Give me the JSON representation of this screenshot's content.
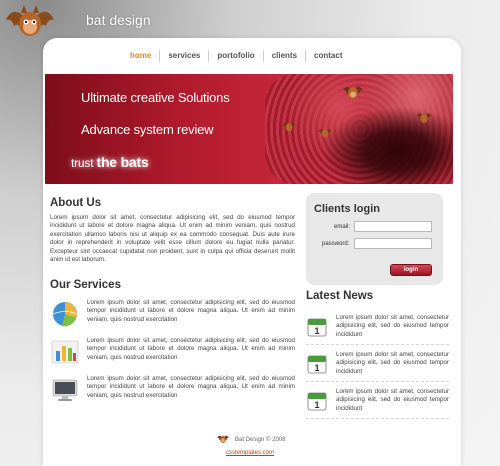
{
  "header": {
    "brand": "bat design",
    "logo_icon": "bat-logo-icon"
  },
  "nav": {
    "items": [
      {
        "label": "home",
        "active": true
      },
      {
        "label": "services",
        "active": false
      },
      {
        "label": "portofolio",
        "active": false
      },
      {
        "label": "clients",
        "active": false
      },
      {
        "label": "contact",
        "active": false
      }
    ]
  },
  "banner": {
    "line1": "Ultimate creative Solutions",
    "line2": "Advance system review",
    "line3_prefix": "trust ",
    "line3_bold": "the bats"
  },
  "about": {
    "title": "About Us",
    "body": "Lorem ipsum dolor sit amet, consectetur adipisicing elit, sed do eiusmod tempor incididunt ut labore et dolore magna aliqua. Ut enim ad minim veniam, quis nostrud exercitation ullamco laboris nisi ut aliquip ex ea commodo consequat. Duis aute irure dolor in reprehenderit in voluptate velit esse cillum dolore eu fugiat nulla pariatur. Excepteur sint occaecat cupidatat non proident, sunt in culpa qui officia deserunt mollit anim id est laborum."
  },
  "services": {
    "title": "Our Services",
    "items": [
      {
        "icon": "globe-chart-icon",
        "text": "Lorem ipsum dolor sit amet, consectetur adipisicing elit, sed do eiusmod tempor incididunt ut labore et dolore magna aliqua. Ut enim ad minim veniam, quis nostrud exercitation"
      },
      {
        "icon": "bar-chart-icon",
        "text": "Lorem ipsum dolor sit amet, consectetur adipisicing elit, sed do eiusmod tempor incididunt ut labore et dolore magna aliqua. Ut enim ad minim veniam, quis nostrud exercitation"
      },
      {
        "icon": "monitor-icon",
        "text": "Lorem ipsum dolor sit amet, consectetur adipisicing elit, sed do eiusmod tempor incididunt ut labore et dolore magna aliqua. Ut enim ad minim veniam, quis nostrud exercitation"
      }
    ]
  },
  "login": {
    "title": "Clients login",
    "email_label": "email:",
    "password_label": "password:",
    "button": "login"
  },
  "news": {
    "title": "Latest News",
    "items": [
      {
        "icon": "calendar-icon",
        "day": "1",
        "text": "Lorem ipsum dolor sit amet, consectetur adipisicing elit, sed do eiusmod tempor incididunt"
      },
      {
        "icon": "calendar-icon",
        "day": "1",
        "text": "Lorem ipsum dolor sit amet, consectetur adipisicing elit, sed do eiusmod tempor incididunt"
      },
      {
        "icon": "calendar-icon",
        "day": "1",
        "text": "Lorem ipsum dolor sit amet, consectetur adipisicing elit, sed do eiusmod tempor incididunt"
      }
    ]
  },
  "footer": {
    "copyright": "Bat Design © 2008",
    "link": "csstemplates.com"
  },
  "colors": {
    "accent": "#e0872a",
    "banner": "#b31b2d",
    "button": "#9c1322"
  }
}
